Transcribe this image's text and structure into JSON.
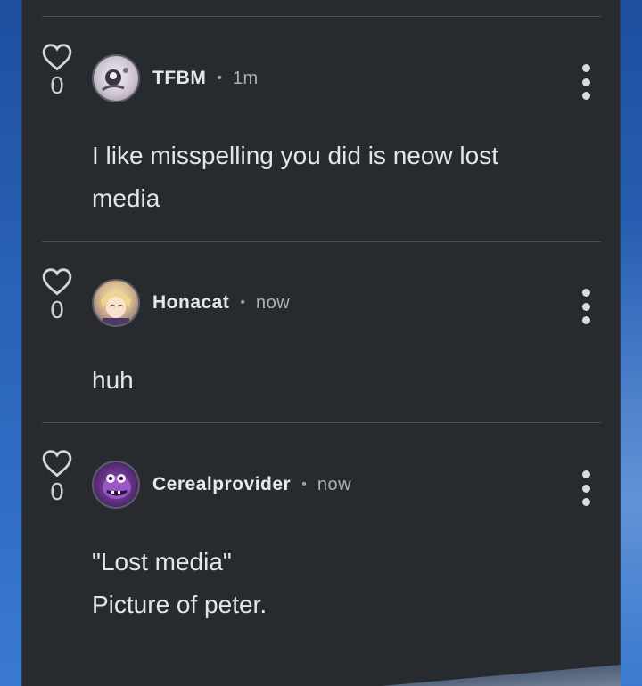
{
  "comments": [
    {
      "username": "TFBM",
      "time": "1m",
      "likes": "0",
      "lines": [
        "I like misspelling you did is neow lost",
        "media"
      ],
      "avatar": "robot-sketch-avatar"
    },
    {
      "username": "Honacat",
      "time": "now",
      "likes": "0",
      "lines": [
        "huh"
      ],
      "avatar": "anime-blond-avatar"
    },
    {
      "username": "Cerealprovider",
      "time": "now",
      "likes": "0",
      "lines": [
        "\"Lost media\"",
        "Picture of peter."
      ],
      "avatar": "purple-creature-avatar"
    }
  ],
  "separator": "•",
  "icons": {
    "like": "heart-outline-icon",
    "menu": "more-vertical-icon"
  },
  "colors": {
    "panel": "#272b30",
    "background": "#2a63b8",
    "text": "#e3e5e8"
  }
}
